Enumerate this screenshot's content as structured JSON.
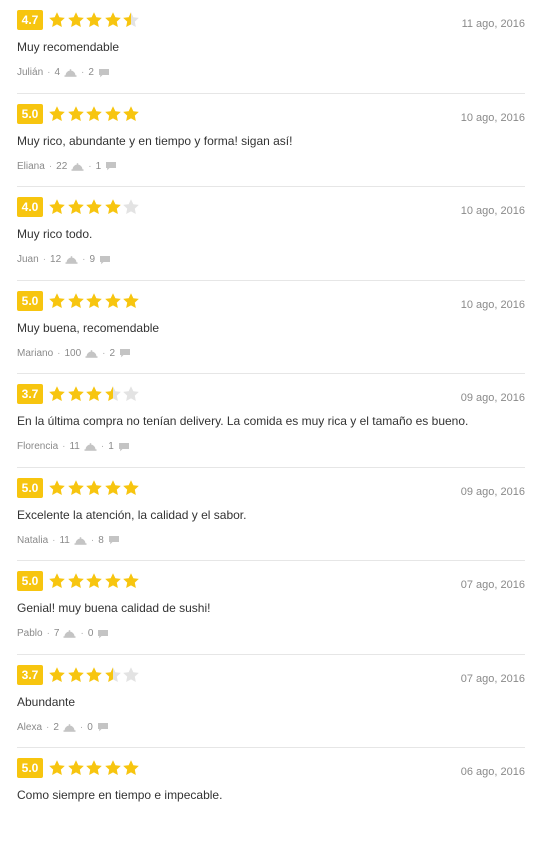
{
  "colors": {
    "star_on": "#f7c50f",
    "star_off": "#e3e3e3",
    "score_bg": "#f7c50f"
  },
  "icons": {
    "orders": "cloche-icon",
    "comments": "speech-bubble-icon"
  },
  "reviews": [
    {
      "score": "4.7",
      "rating": 4.7,
      "date": "11 ago, 2016",
      "text": "Muy recomendable",
      "user": "Julián",
      "orders": "4",
      "comments": "2"
    },
    {
      "score": "5.0",
      "rating": 5.0,
      "date": "10 ago, 2016",
      "text": "Muy rico, abundante y en tiempo y forma! sigan así!",
      "user": "Eliana",
      "orders": "22",
      "comments": "1"
    },
    {
      "score": "4.0",
      "rating": 4.0,
      "date": "10 ago, 2016",
      "text": "Muy rico todo.",
      "user": "Juan",
      "orders": "12",
      "comments": "9"
    },
    {
      "score": "5.0",
      "rating": 5.0,
      "date": "10 ago, 2016",
      "text": "Muy buena, recomendable",
      "user": "Mariano",
      "orders": "100",
      "comments": "2"
    },
    {
      "score": "3.7",
      "rating": 3.7,
      "date": "09 ago, 2016",
      "text": "En la última compra no tenían delivery. La comida es muy rica y el tamaño es bueno.",
      "user": "Florencia",
      "orders": "11",
      "comments": "1"
    },
    {
      "score": "5.0",
      "rating": 5.0,
      "date": "09 ago, 2016",
      "text": "Excelente la atención, la calidad y el sabor.",
      "user": "Natalia",
      "orders": "11",
      "comments": "8"
    },
    {
      "score": "5.0",
      "rating": 5.0,
      "date": "07 ago, 2016",
      "text": "Genial! muy buena calidad de sushi!",
      "user": "Pablo",
      "orders": "7",
      "comments": "0"
    },
    {
      "score": "3.7",
      "rating": 3.7,
      "date": "07 ago, 2016",
      "text": "Abundante",
      "user": "Alexa",
      "orders": "2",
      "comments": "0"
    },
    {
      "score": "5.0",
      "rating": 5.0,
      "date": "06 ago, 2016",
      "text": "Como siempre en tiempo e impecable.",
      "user": "",
      "orders": "",
      "comments": ""
    }
  ]
}
